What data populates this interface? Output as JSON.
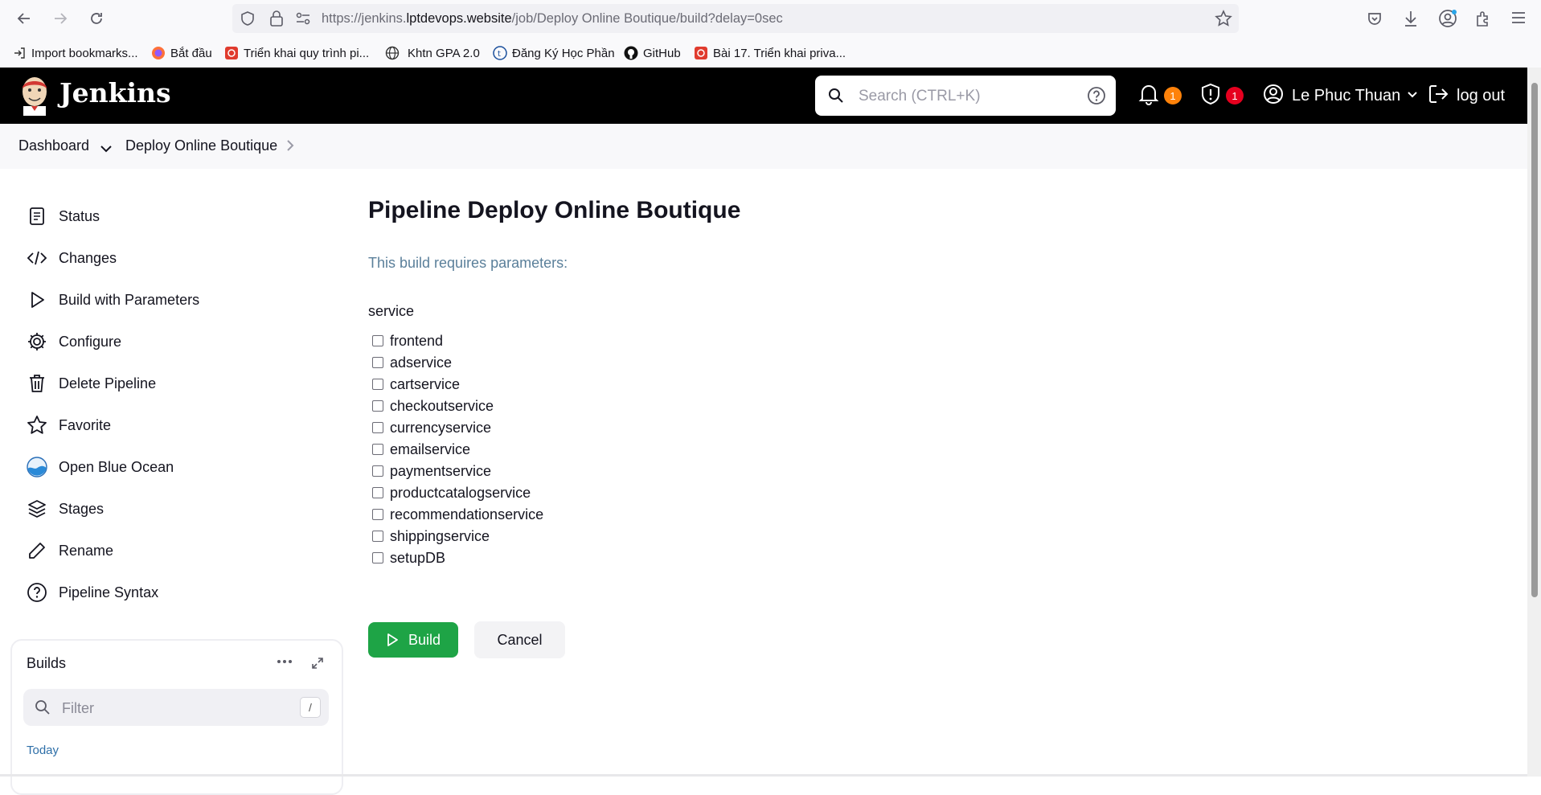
{
  "browser": {
    "url_prefix": "https://jenkins.",
    "url_host": "lptdevops.website",
    "url_path": "/job/Deploy Online Boutique/build?delay=0sec",
    "bookmarks": [
      {
        "label": "Import bookmarks...",
        "icon": "import-icon"
      },
      {
        "label": "Bắt đầu",
        "icon": "firefox-icon"
      },
      {
        "label": "Triển khai quy trình pi...",
        "icon": "bookmark-red-icon"
      },
      {
        "label": "Khtn GPA 2.0",
        "icon": "globe-icon"
      },
      {
        "label": "Đăng Ký Học Phần",
        "icon": "school-icon"
      },
      {
        "label": "GitHub",
        "icon": "github-icon"
      },
      {
        "label": "Bài 17. Triển khai priva...",
        "icon": "bookmark-red-icon"
      }
    ]
  },
  "header": {
    "app_title": "Jenkins",
    "search_placeholder": "Search (CTRL+K)",
    "notifications_count": "1",
    "security_count": "1",
    "user_name": "Le Phuc Thuan",
    "logout_label": "log out"
  },
  "breadcrumb": {
    "items": [
      "Dashboard",
      "Deploy Online Boutique"
    ]
  },
  "sidebar": {
    "items": [
      {
        "label": "Status",
        "icon": "notepad-icon"
      },
      {
        "label": "Changes",
        "icon": "code-icon"
      },
      {
        "label": "Build with Parameters",
        "icon": "play-icon"
      },
      {
        "label": "Configure",
        "icon": "gear-icon"
      },
      {
        "label": "Delete Pipeline",
        "icon": "trash-icon"
      },
      {
        "label": "Favorite",
        "icon": "star-icon"
      },
      {
        "label": "Open Blue Ocean",
        "icon": "blue-ocean-icon"
      },
      {
        "label": "Stages",
        "icon": "layers-icon"
      },
      {
        "label": "Rename",
        "icon": "pencil-icon"
      },
      {
        "label": "Pipeline Syntax",
        "icon": "help-circle-icon"
      }
    ]
  },
  "builds": {
    "title": "Builds",
    "filter_placeholder": "Filter",
    "filter_shortcut": "/",
    "group_label": "Today"
  },
  "main": {
    "title": "Pipeline Deploy Online Boutique",
    "note": "This build requires parameters:",
    "param_name": "service",
    "options": [
      "frontend",
      "adservice",
      "cartservice",
      "checkoutservice",
      "currencyservice",
      "emailservice",
      "paymentservice",
      "productcatalogservice",
      "recommendationservice",
      "shippingservice",
      "setupDB"
    ],
    "build_label": "Build",
    "cancel_label": "Cancel"
  },
  "colors": {
    "header_bg": "#000000",
    "build_green": "#1ea446",
    "note_blue": "#5a7f9a",
    "badge_orange": "#fe820a",
    "badge_red": "#e6001f"
  }
}
